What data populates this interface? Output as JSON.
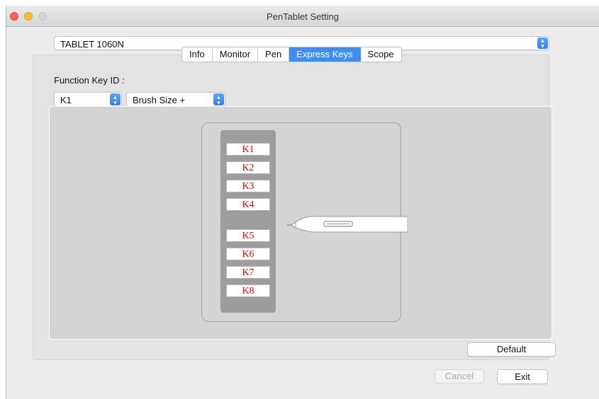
{
  "window": {
    "title": "PenTablet Setting"
  },
  "device_select": {
    "value": "TABLET 1060N"
  },
  "tabs": [
    {
      "label": "Info"
    },
    {
      "label": "Monitor"
    },
    {
      "label": "Pen"
    },
    {
      "label": "Express Keys",
      "active": true
    },
    {
      "label": "Scope"
    }
  ],
  "function_key": {
    "label": "Function Key ID :",
    "key_select": "K1",
    "action_select": "Brush Size +"
  },
  "keys": [
    "K1",
    "K2",
    "K3",
    "K4",
    "K5",
    "K6",
    "K7",
    "K8"
  ],
  "buttons": {
    "default": "Default",
    "cancel": "Cancel",
    "exit": "Exit"
  },
  "colors": {
    "accent": "#3d8ef4",
    "key_text": "#e00000"
  }
}
